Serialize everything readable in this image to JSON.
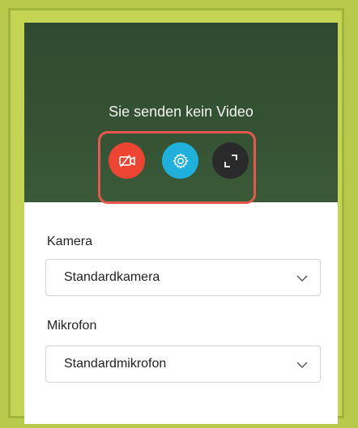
{
  "video": {
    "status_text": "Sie senden kein Video"
  },
  "controls": {
    "camera_toggle": {
      "icon": "camera-off-icon",
      "color": "#ee4533"
    },
    "settings": {
      "icon": "gear-icon",
      "color": "#1fb0dc"
    },
    "fullscreen": {
      "icon": "expand-icon",
      "color": "#2a2a2a"
    },
    "highlight_color": "#e8574f"
  },
  "form": {
    "camera_label": "Kamera",
    "camera_value": "Standardkamera",
    "microphone_label": "Mikrofon",
    "microphone_value": "Standardmikrofon"
  }
}
